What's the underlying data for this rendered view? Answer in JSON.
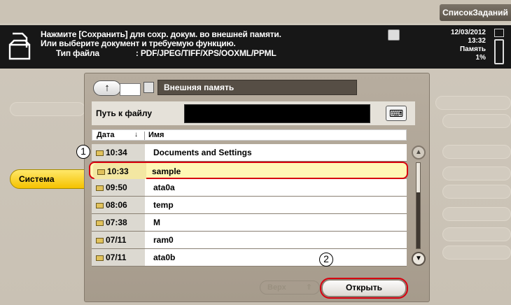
{
  "topbar": {
    "job_list_label": "СписокЗаданий"
  },
  "message": {
    "line1": "Нажмите [Сохранить] для сохр. докум. во внешней памяти.",
    "line2": "Или выберите документ и требуемую функцию.",
    "file_type_label": "Тип файла",
    "file_type_value": ": PDF/JPEG/TIFF/XPS/OOXML/PPML"
  },
  "status": {
    "date": "12/03/2012",
    "time": "13:32",
    "memory_label": "Память",
    "memory_value": "1%"
  },
  "left_menu": {
    "selected_label": "Система"
  },
  "browser": {
    "location_label": "Внешняя память",
    "path_label": "Путь к файлу",
    "keyboard_icon": "⌨",
    "col_date": "Дата",
    "col_sort": "↓",
    "col_name": "Имя",
    "files": [
      {
        "date": "10:34",
        "name": "Documents and Settings"
      },
      {
        "date": "10:33",
        "name": "sample"
      },
      {
        "date": "09:50",
        "name": "ata0a"
      },
      {
        "date": "08:06",
        "name": "temp"
      },
      {
        "date": "07:38",
        "name": "M"
      },
      {
        "date": "07/11",
        "name": "ram0"
      },
      {
        "date": "07/11",
        "name": "ata0b"
      }
    ],
    "top_button": "Верх",
    "open_button": "Открыть"
  },
  "callouts": {
    "first": "1",
    "second": "2"
  },
  "colors": {
    "selection": "#fff7b5",
    "highlight_outline": "#d7000f",
    "active_tab": "#f5c200"
  }
}
